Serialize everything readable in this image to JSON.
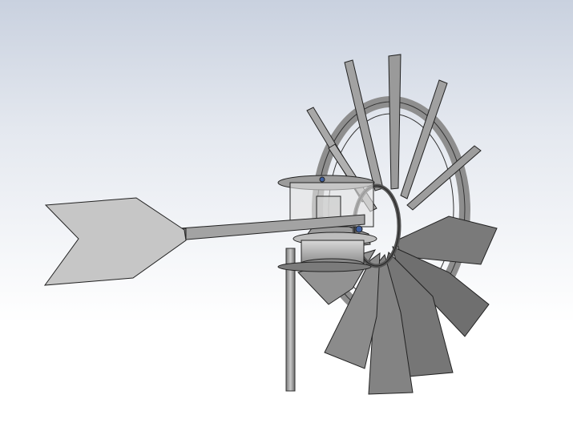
{
  "scene": {
    "subject": "windmill-cad-model",
    "colors": {
      "background_top": "#c9d1df",
      "background_bottom": "#ffffff",
      "part_fill": "#8d8d8d",
      "part_light": "#c8c8c8",
      "part_dark": "#5a5a5a",
      "edge": "#2a2a2a"
    }
  }
}
